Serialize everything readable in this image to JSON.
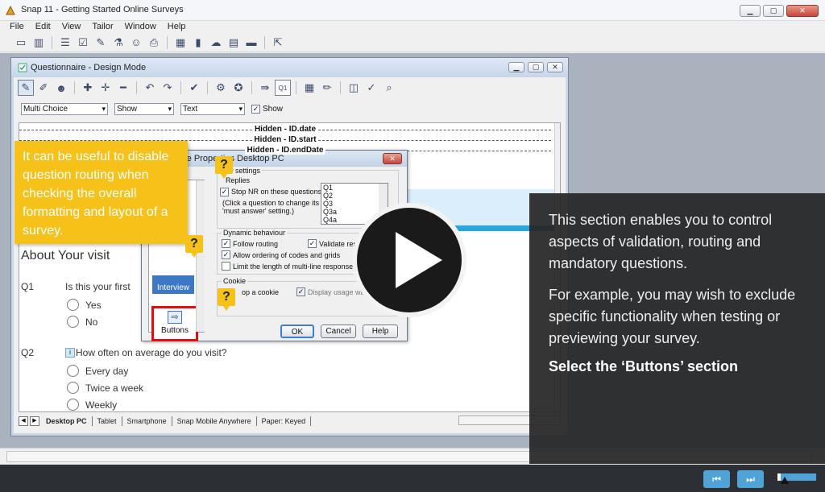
{
  "app": {
    "title": "Snap 11 - Getting Started Online Surveys",
    "menu": [
      "File",
      "Edit",
      "View",
      "Tailor",
      "Window",
      "Help"
    ]
  },
  "questionnaire_window": {
    "title": "Questionnaire - Design Mode",
    "selects": {
      "question_type": "Multi Choice",
      "show": "Show",
      "text": "Text",
      "show_checkbox_label": "Show",
      "show_checked": true
    },
    "hidden_lines": [
      "Hidden - ID.date",
      "Hidden - ID.start",
      "Hidden - ID.endDate"
    ],
    "section_heading": "About Your visit",
    "questions": [
      {
        "num": "Q1",
        "text": "Is this your first",
        "options": [
          "Yes",
          "No"
        ]
      },
      {
        "num": "Q2",
        "text": "How often on average do you visit?",
        "options": [
          "Every day",
          "Twice a week",
          "Weekly"
        ]
      }
    ],
    "tabs": [
      "Desktop PC",
      "Tablet",
      "Smartphone",
      "Snap Mobile Anywhere",
      "Paper: Keyed"
    ],
    "active_tab": "Desktop PC"
  },
  "dialog": {
    "title": "re Properties Desktop PC",
    "categories": {
      "interview": "Interview",
      "buttons": "Buttons"
    },
    "group_view_settings": "ew settings",
    "replies_label": "Replies",
    "stop_nr_label": "Stop NR on these questions",
    "stop_nr_checked": true,
    "stop_nr_hint_1": "(Click a question to change its",
    "stop_nr_hint_2": "'must answer' setting.)",
    "question_list": [
      "Q1",
      "Q2",
      "Q3",
      "Q3a",
      "Q4a"
    ],
    "group_dynamic": "Dynamic behaviour",
    "follow_routing": "Follow routing",
    "validate_responses": "Validate res",
    "allow_ordering": "Allow ordering of codes and grids",
    "limit_length": "Limit the length of multi-line responses",
    "group_cookie": "Cookie",
    "stop_cookie": "op a cookie",
    "display_usage": "Display usage warn",
    "ok": "OK",
    "cancel": "Cancel",
    "help": "Help"
  },
  "tooltip": {
    "text": "It can be useful to disable question routing when checking the overall formatting and layout of a survey.",
    "marker": "?"
  },
  "panel": {
    "para1": "This section enables you to control aspects of validation, routing and mandatory questions.",
    "para2": "For example, you may wish to exclude specific functionality when testing or previewing your survey.",
    "instruction": "Select the ‘Buttons’ section"
  },
  "player": {
    "progress": 0.08
  },
  "colors": {
    "tooltip": "#f6c21a",
    "accent": "#4fa3d6",
    "highlight_border": "#e10d12",
    "panel_bg": "#262626"
  }
}
